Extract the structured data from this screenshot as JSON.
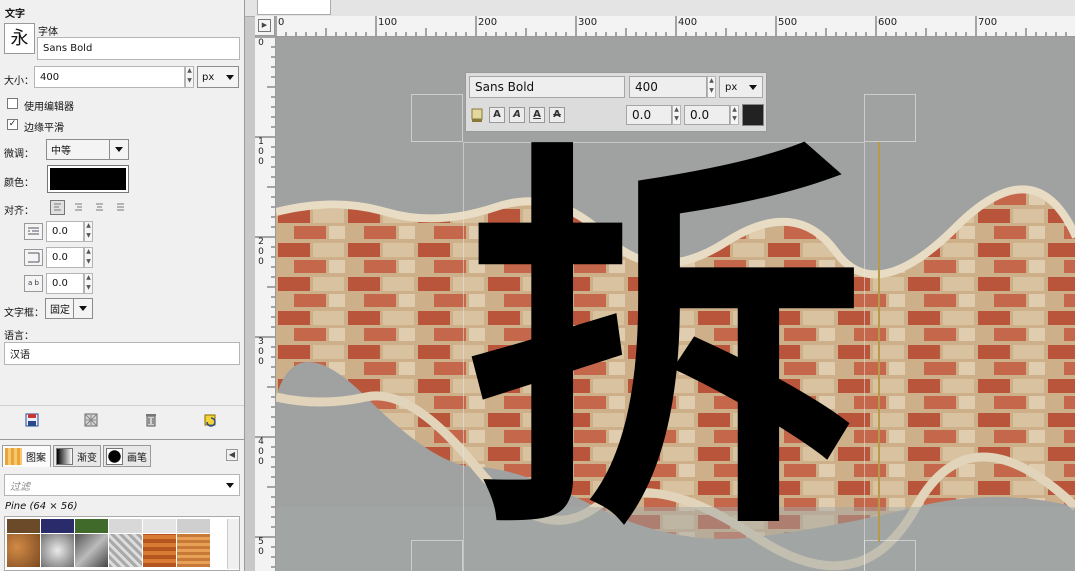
{
  "panel": {
    "title": "文字",
    "font_preview_glyph": "永",
    "font_label": "字体",
    "font_value": "Sans Bold",
    "size_label": "大小：",
    "size_value": "400",
    "size_unit": "px",
    "use_editor_label": "使用编辑器",
    "use_editor_checked": false,
    "antialias_label": "边缘平滑",
    "antialias_checked": true,
    "hinting_label": "微调：",
    "hinting_value": "中等",
    "color_label": "颜色：",
    "color_value": "#000000",
    "justify_label": "对齐：",
    "indent_value": "0.0",
    "line_spacing_value": "0.0",
    "letter_spacing_value": "0.0",
    "letter_spacing_icon": "a b",
    "box_label": "文字框：",
    "box_value": "固定",
    "language_label": "语言：",
    "language_value": "汉语"
  },
  "bottom_icons": [
    "save-options-icon",
    "restore-options-icon",
    "delete-icon",
    "reset-icon"
  ],
  "tabs": [
    {
      "label": "图案",
      "name": "tab-patterns"
    },
    {
      "label": "渐变",
      "name": "tab-gradients"
    },
    {
      "label": "画笔",
      "name": "tab-brushes"
    }
  ],
  "patterns": {
    "filter_placeholder": "过滤",
    "selected_info": "Pine (64 × 56)"
  },
  "canvas": {
    "ruler_top_labels": [
      "0",
      "100",
      "200",
      "300",
      "400",
      "500",
      "600",
      "700"
    ],
    "ruler_left_labels": [
      "0",
      "1\n0\n0",
      "2\n0\n0",
      "3\n0\n0",
      "4\n0\n0",
      "5\n0"
    ],
    "text_glyph": "拆",
    "text_color": "#000000"
  },
  "overlay": {
    "font": "Sans Bold",
    "size": "400",
    "unit": "px",
    "baseline": "0.0",
    "kerning": "0.0"
  }
}
